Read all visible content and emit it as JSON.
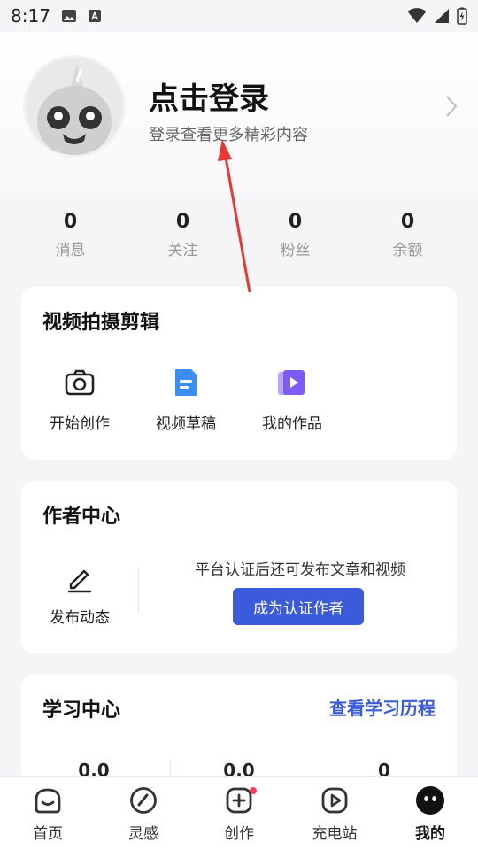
{
  "status_bar": {
    "time": "8:17"
  },
  "profile": {
    "title": "点击登录",
    "subtitle": "登录查看更多精彩内容"
  },
  "stats": [
    {
      "value": "0",
      "label": "消息"
    },
    {
      "value": "0",
      "label": "关注"
    },
    {
      "value": "0",
      "label": "粉丝"
    },
    {
      "value": "0",
      "label": "余额"
    }
  ],
  "video_section": {
    "title": "视频拍摄剪辑",
    "tools": [
      {
        "label": "开始创作",
        "icon": "camera-icon"
      },
      {
        "label": "视频草稿",
        "icon": "document-icon"
      },
      {
        "label": "我的作品",
        "icon": "video-play-icon"
      }
    ]
  },
  "author_center": {
    "title": "作者中心",
    "post_label": "发布动态",
    "note": "平台认证后还可发布文章和视频",
    "cert_button": "成为认证作者"
  },
  "learning_center": {
    "title": "学习中心",
    "link": "查看学习历程",
    "values": [
      "0.0",
      "0.0",
      "0"
    ]
  },
  "bottom_nav": [
    {
      "label": "首页",
      "icon": "home-icon"
    },
    {
      "label": "灵感",
      "icon": "compass-icon"
    },
    {
      "label": "创作",
      "icon": "create-plus-icon"
    },
    {
      "label": "充电站",
      "icon": "play-station-icon"
    },
    {
      "label": "我的",
      "icon": "profile-face-icon"
    }
  ],
  "colors": {
    "accent": "#3b5bdb",
    "badge": "#f03e5a",
    "annotation_arrow": "#e53935"
  }
}
